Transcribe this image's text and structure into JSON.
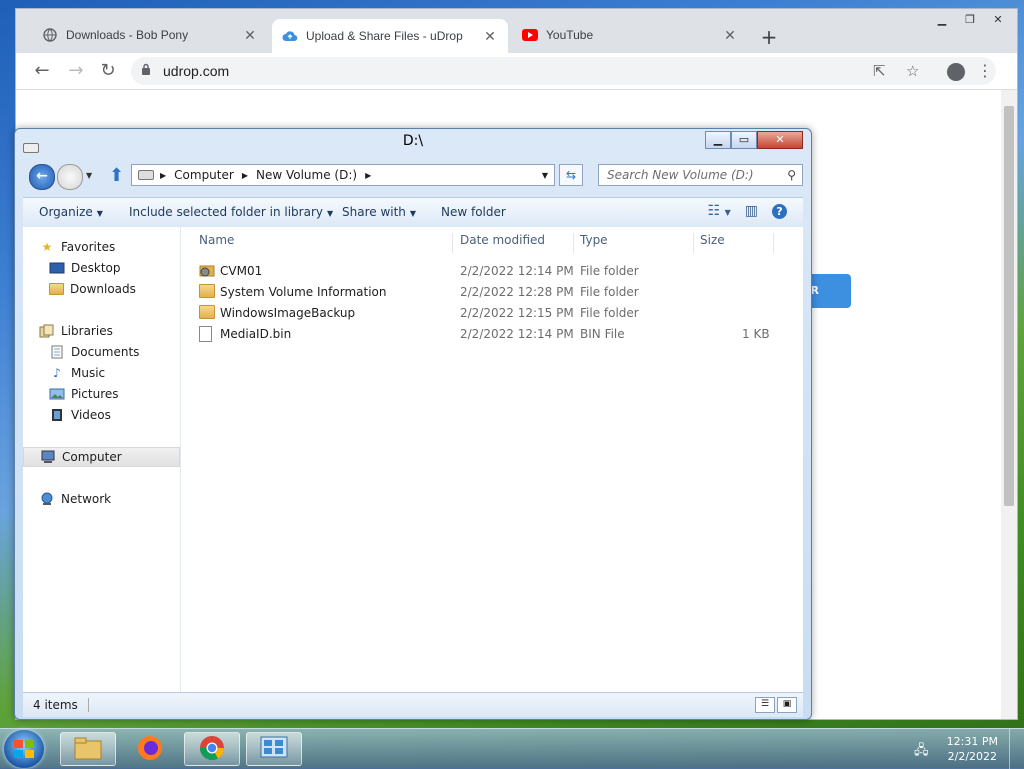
{
  "browser": {
    "tabs": [
      {
        "title": "Downloads - Bob Pony",
        "icon": "globe-icon",
        "active": false
      },
      {
        "title": "Upload & Share Files - uDrop",
        "icon": "cloud-icon",
        "active": true
      },
      {
        "title": "YouTube",
        "icon": "youtube-icon",
        "active": false
      }
    ],
    "url": "udrop.com",
    "page_button_text": "ER"
  },
  "explorer": {
    "title": "D:\\",
    "breadcrumb": [
      "Computer",
      "New Volume (D:)"
    ],
    "search_placeholder": "Search New Volume (D:)",
    "commands": {
      "organize": "Organize",
      "include": "Include selected folder in library",
      "share": "Share with",
      "new_folder": "New folder"
    },
    "nav": {
      "favorites": "Favorites",
      "desktop": "Desktop",
      "downloads": "Downloads",
      "libraries": "Libraries",
      "documents": "Documents",
      "music": "Music",
      "pictures": "Pictures",
      "videos": "Videos",
      "computer": "Computer",
      "network": "Network"
    },
    "columns": {
      "name": "Name",
      "date": "Date modified",
      "type": "Type",
      "size": "Size"
    },
    "files": [
      {
        "name": "CVM01",
        "date": "2/2/2022 12:14 PM",
        "type": "File folder",
        "size": ""
      },
      {
        "name": "System Volume Information",
        "date": "2/2/2022 12:28 PM",
        "type": "File folder",
        "size": ""
      },
      {
        "name": "WindowsImageBackup",
        "date": "2/2/2022 12:15 PM",
        "type": "File folder",
        "size": ""
      },
      {
        "name": "MediaID.bin",
        "date": "2/2/2022 12:14 PM",
        "type": "BIN File",
        "size": "1 KB"
      }
    ],
    "status": "4 items"
  },
  "taskbar": {
    "time": "12:31 PM",
    "date": "2/2/2022"
  }
}
